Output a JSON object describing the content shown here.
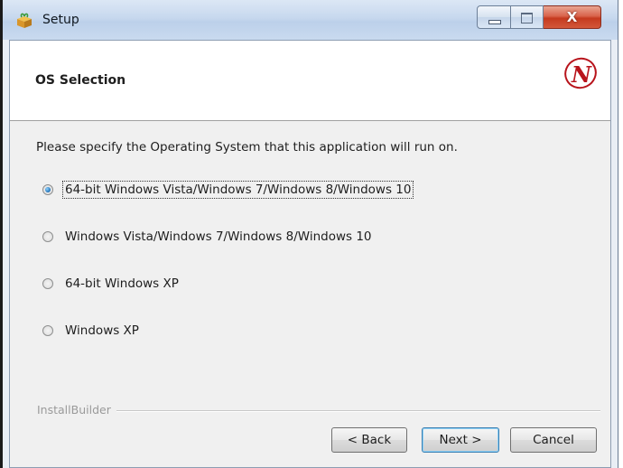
{
  "window": {
    "title": "Setup",
    "close_glyph": "X"
  },
  "header": {
    "title": "OS Selection",
    "logo_letter": "N"
  },
  "instruction": "Please specify the Operating System that this application will run on.",
  "options": [
    {
      "label": "64-bit Windows Vista/Windows 7/Windows 8/Windows 10",
      "selected": true
    },
    {
      "label": "Windows Vista/Windows 7/Windows 8/Windows 10",
      "selected": false
    },
    {
      "label": "64-bit Windows XP",
      "selected": false
    },
    {
      "label": "Windows XP",
      "selected": false
    }
  ],
  "branding": "InstallBuilder",
  "buttons": {
    "back": "< Back",
    "next": "Next >",
    "cancel": "Cancel"
  },
  "colors": {
    "accent": "#3c7fb1",
    "close_button": "#c53a1f",
    "logo": "#b8141c"
  },
  "icons": {
    "app": "setup-box-icon",
    "logo": "n-logo-icon"
  }
}
